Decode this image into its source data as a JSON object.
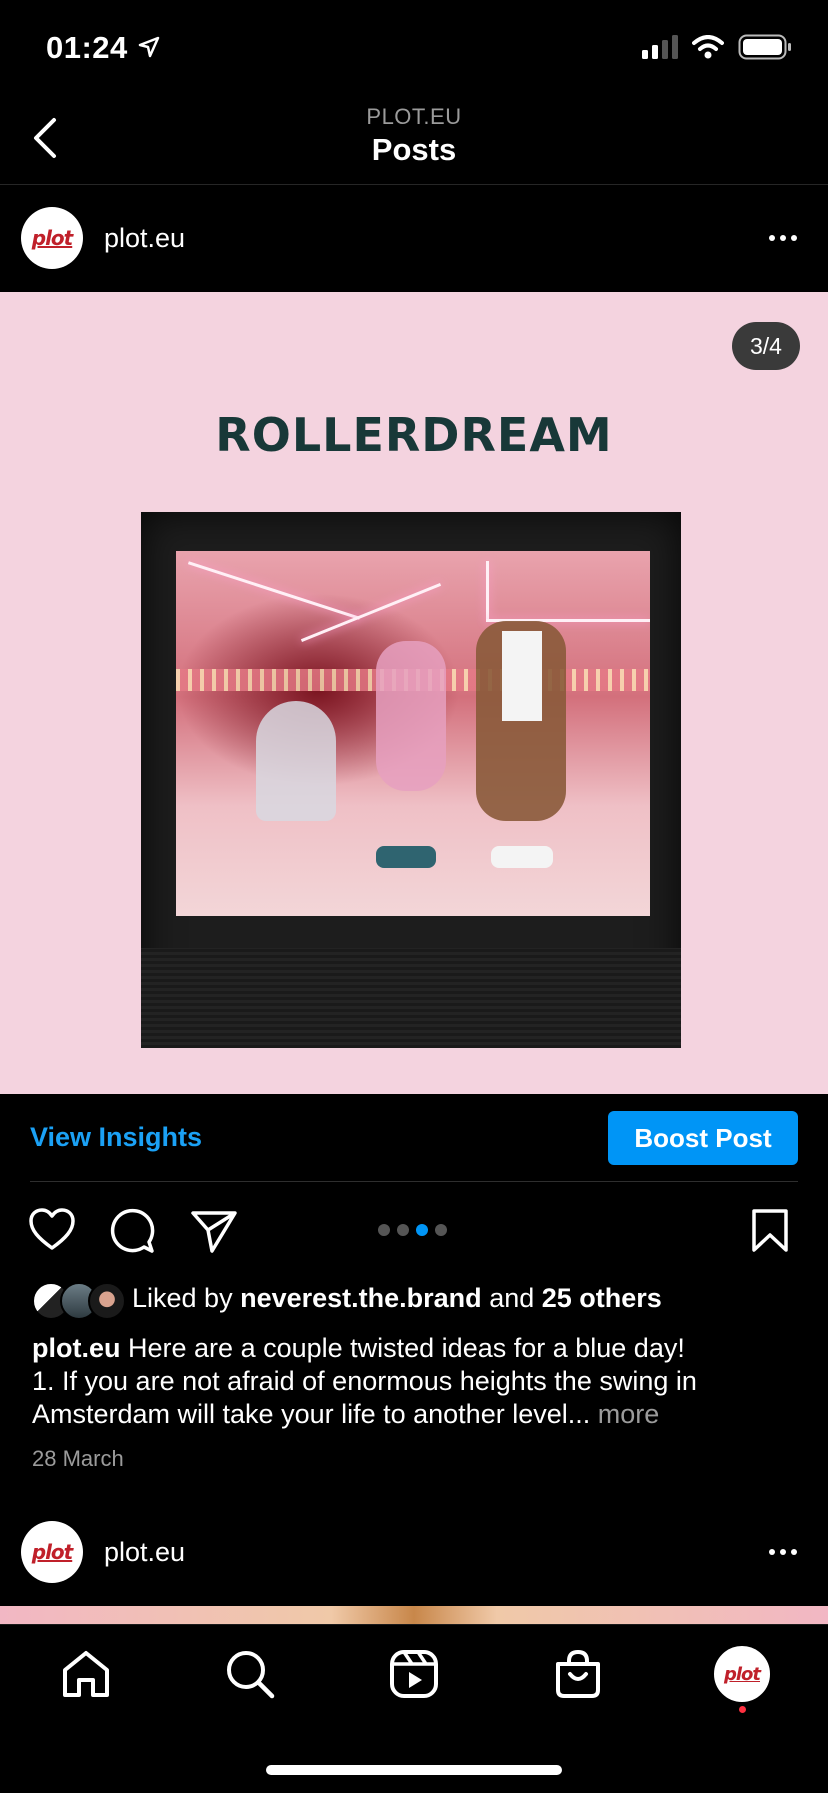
{
  "status_bar": {
    "time": "01:24"
  },
  "header": {
    "handle": "PLOT.EU",
    "title": "Posts"
  },
  "post": {
    "avatar_text": "plot",
    "username": "plot.eu",
    "counter": "3/4",
    "poster_title": "ROLLERDREAM",
    "actions": {
      "view_insights": "View Insights",
      "boost_post": "Boost Post"
    },
    "carousel": {
      "count": 4,
      "active_index": 2
    },
    "likes": {
      "prefix": "Liked by",
      "user": "neverest.the.brand",
      "conj": "and",
      "others": "25 others"
    },
    "caption": {
      "username": "plot.eu",
      "line1": "Here are a couple twisted ideas for a blue day!",
      "line2": "1. If you are not afraid of enormous heights the swing in",
      "line3": "Amsterdam will take your life to another level...",
      "more": "more"
    },
    "date": "28 March"
  },
  "next_post": {
    "avatar_text": "plot",
    "username": "plot.eu"
  },
  "tabbar": {
    "items": [
      "home-icon",
      "search-icon",
      "reels-icon",
      "shop-icon",
      "profile-avatar"
    ],
    "profile_avatar_text": "plot"
  },
  "colors": {
    "accent": "#0095f6",
    "link": "#1ba1f5",
    "poster_bg": "#f4d3df",
    "notification": "#ff3040"
  }
}
